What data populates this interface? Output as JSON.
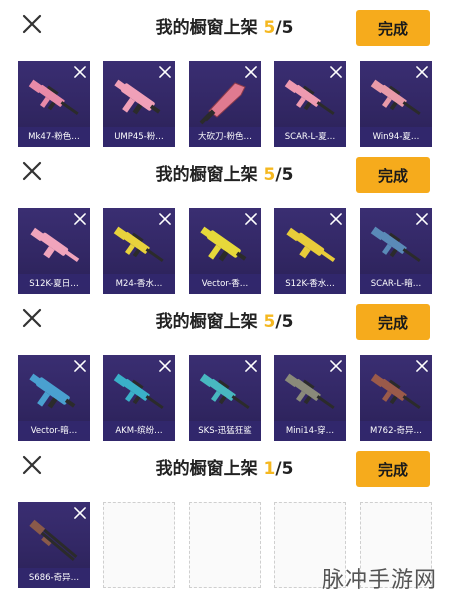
{
  "sections": [
    {
      "title": "我的橱窗上架",
      "count": "5",
      "sep": "/",
      "max": "5",
      "done_label": "完成",
      "items": [
        {
          "name": "Mk47-粉色…",
          "icon": "rifle-icon",
          "color": "#e88aa8"
        },
        {
          "name": "UMP45-粉…",
          "icon": "smg-icon",
          "color": "#f0a0b8"
        },
        {
          "name": "大砍刀-粉色…",
          "icon": "machete-icon",
          "color": "#e07a90"
        },
        {
          "name": "SCAR-L-夏…",
          "icon": "rifle-icon",
          "color": "#ee9ab0"
        },
        {
          "name": "Win94-夏…",
          "icon": "lever-rifle-icon",
          "color": "#e89aa8"
        }
      ]
    },
    {
      "title": "我的橱窗上架",
      "count": "5",
      "sep": "/",
      "max": "5",
      "done_label": "完成",
      "items": [
        {
          "name": "S12K-夏日…",
          "icon": "shotgun-icon",
          "color": "#f0a4bc"
        },
        {
          "name": "M24-香水…",
          "icon": "sniper-icon",
          "color": "#e8d23c"
        },
        {
          "name": "Vector-香…",
          "icon": "smg-icon",
          "color": "#e6d83a"
        },
        {
          "name": "S12K-香水…",
          "icon": "shotgun-icon",
          "color": "#e8cc3a"
        },
        {
          "name": "SCAR-L-暗…",
          "icon": "rifle-icon",
          "color": "#5a8ab8"
        }
      ]
    },
    {
      "title": "我的橱窗上架",
      "count": "5",
      "sep": "/",
      "max": "5",
      "done_label": "完成",
      "items": [
        {
          "name": "Vector-暗…",
          "icon": "smg-icon",
          "color": "#4aa0d0"
        },
        {
          "name": "AKM-缤纷…",
          "icon": "rifle-icon",
          "color": "#3ab0c8"
        },
        {
          "name": "SKS-迅猛狂鲨",
          "icon": "rifle-icon",
          "color": "#48b8c0"
        },
        {
          "name": "Mini14-穿…",
          "icon": "rifle-icon",
          "color": "#8a8a7a"
        },
        {
          "name": "M762-奇异…",
          "icon": "rifle-icon",
          "color": "#9a5a4a"
        }
      ]
    },
    {
      "title": "我的橱窗上架",
      "count": "1",
      "sep": "/",
      "max": "5",
      "done_label": "完成",
      "items": [
        {
          "name": "S686-奇异…",
          "icon": "double-barrel-shotgun-icon",
          "color": "#8a5a4a"
        }
      ]
    }
  ],
  "watermark": "脉冲手游网"
}
